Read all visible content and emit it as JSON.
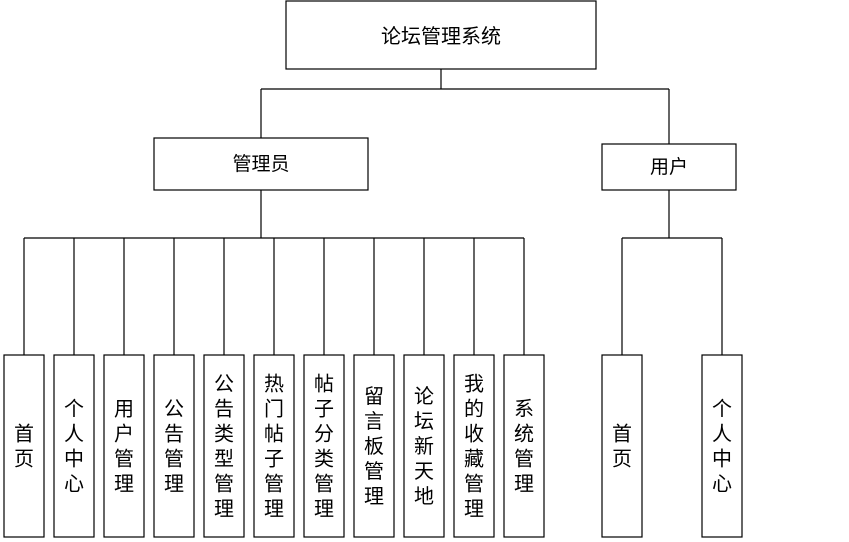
{
  "diagram": {
    "root": {
      "label": "论坛管理系统"
    },
    "roles": [
      {
        "label": "管理员",
        "modules": [
          "首页",
          "个人中心",
          "用户管理",
          "公告管理",
          "公告类型管理",
          "热门帖子管理",
          "帖子分类管理",
          "留言板管理",
          "论坛新天地",
          "我的收藏管理",
          "系统管理"
        ]
      },
      {
        "label": "用户",
        "modules": [
          "首页",
          "个人中心"
        ]
      }
    ]
  }
}
